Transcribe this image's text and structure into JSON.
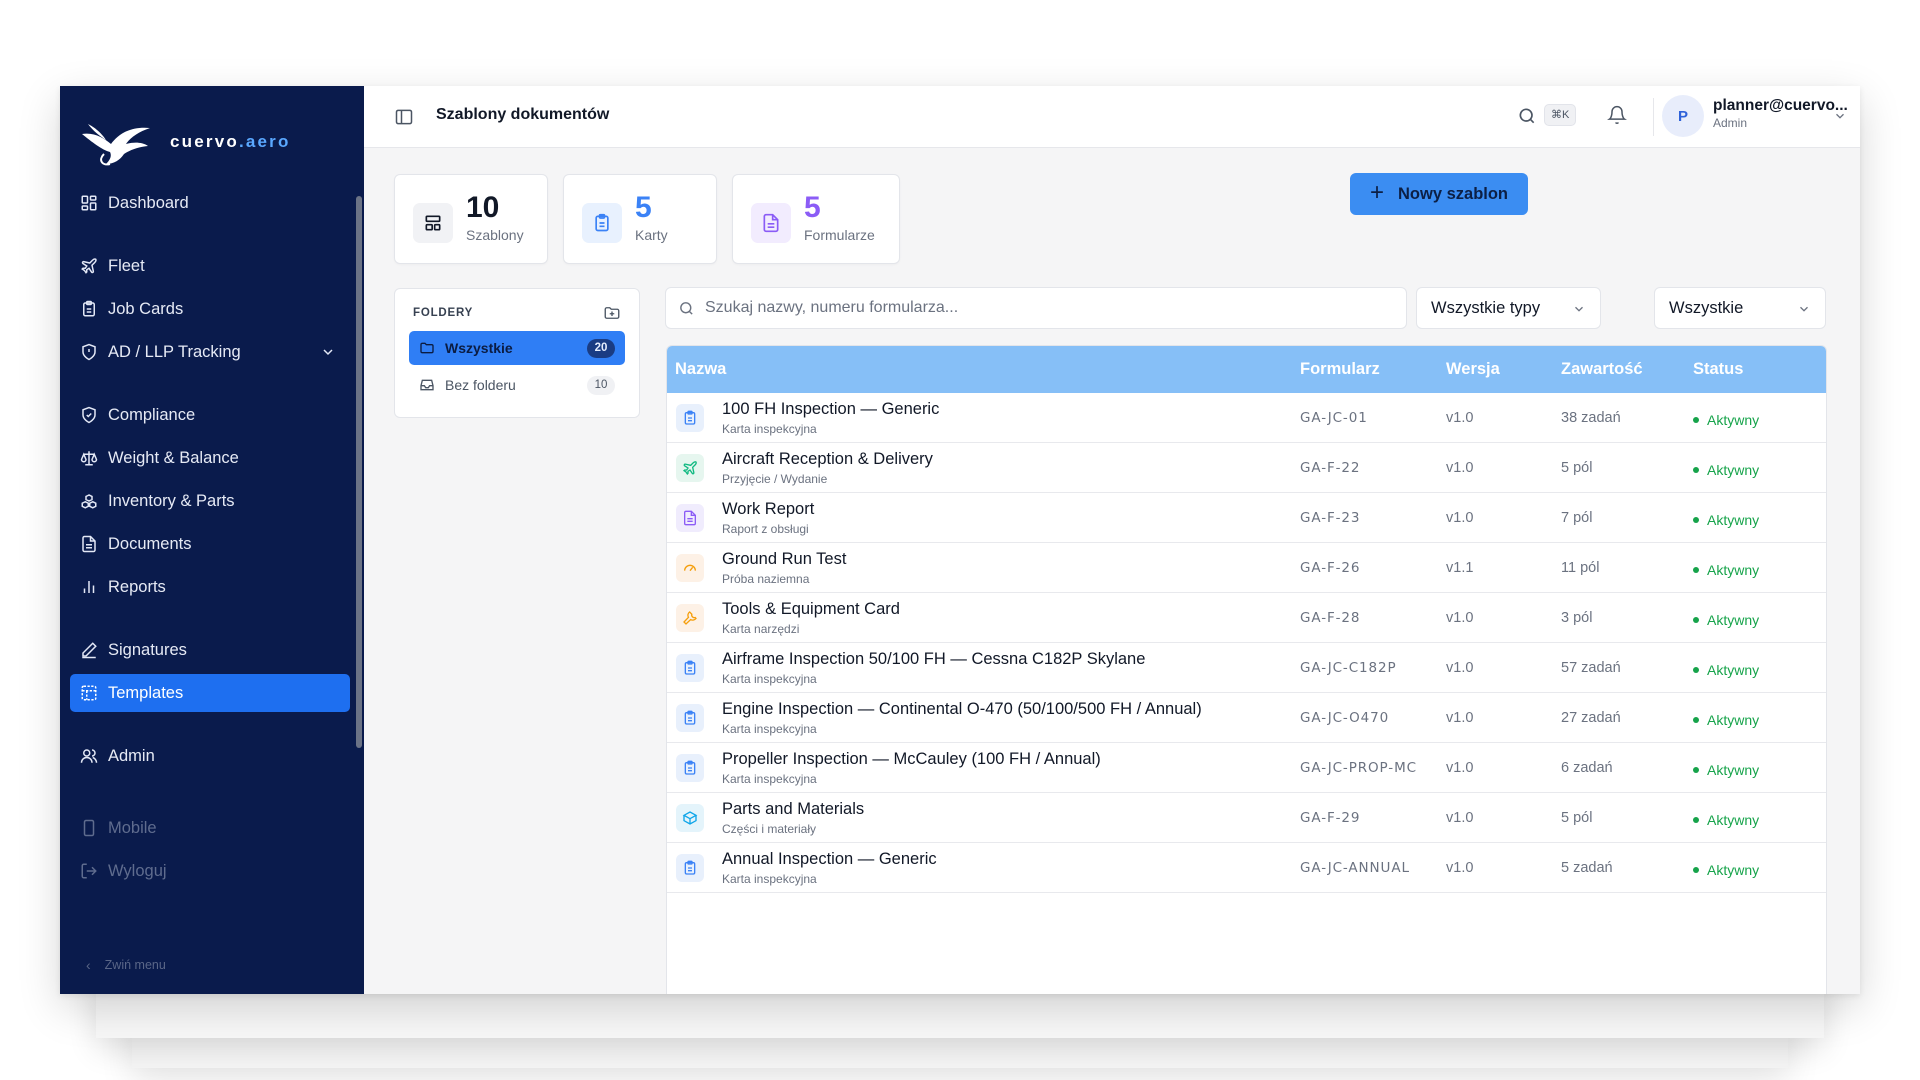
{
  "brand": {
    "name_prefix": "cuervo",
    "name_suffix": ".aero"
  },
  "sidebar": {
    "items": [
      {
        "label": "Dashboard",
        "icon": "dashboard-icon"
      },
      {
        "label": "Fleet",
        "icon": "plane-icon"
      },
      {
        "label": "Job Cards",
        "icon": "clipboard-icon"
      },
      {
        "label": "AD / LLP Tracking",
        "icon": "shield-alert-icon"
      },
      {
        "label": "Compliance",
        "icon": "shield-check-icon"
      },
      {
        "label": "Weight & Balance",
        "icon": "scale-icon"
      },
      {
        "label": "Inventory & Parts",
        "icon": "boxes-icon"
      },
      {
        "label": "Documents",
        "icon": "document-icon"
      },
      {
        "label": "Reports",
        "icon": "bar-chart-icon"
      },
      {
        "label": "Signatures",
        "icon": "pen-icon"
      },
      {
        "label": "Templates",
        "icon": "template-icon",
        "active": true
      },
      {
        "label": "Admin",
        "icon": "users-icon"
      },
      {
        "label": "Mobile",
        "icon": "smartphone-icon"
      },
      {
        "label": "Wyloguj",
        "icon": "logout-icon"
      }
    ],
    "collapse_label": "Zwiń menu"
  },
  "topbar": {
    "title": "Szablony dokumentów",
    "shortcut": "⌘K",
    "user_initial": "P",
    "user_email": "planner@cuervo...",
    "user_role": "Admin"
  },
  "stats": [
    {
      "value": "10",
      "label": "Szablony",
      "color": "#111827"
    },
    {
      "value": "5",
      "label": "Karty",
      "color": "#3b82f6"
    },
    {
      "value": "5",
      "label": "Formularze",
      "color": "#8b5cf6"
    }
  ],
  "new_button": "Nowy szablon",
  "folders": {
    "header": "FOLDERY",
    "items": [
      {
        "label": "Wszystkie",
        "count": "20",
        "active": true
      },
      {
        "label": "Bez folderu",
        "count": "10",
        "active": false
      }
    ]
  },
  "search": {
    "placeholder": "Szukaj nazwy, numeru formularza..."
  },
  "filters": {
    "type": "Wszystkie typy",
    "status": "Wszystkie"
  },
  "table": {
    "columns": [
      "Nazwa",
      "Formularz",
      "Wersja",
      "Zawartość",
      "Status"
    ],
    "rows": [
      {
        "name": "100 FH Inspection — Generic",
        "sub": "Karta inspekcyjna",
        "code": "GA-JC-01",
        "version": "v1.0",
        "content": "38 zadań",
        "status": "Aktywny",
        "icon": "clipboard-icon"
      },
      {
        "name": "Aircraft Reception & Delivery",
        "sub": "Przyjęcie / Wydanie",
        "code": "GA-F-22",
        "version": "v1.0",
        "content": "5 pól",
        "status": "Aktywny",
        "icon": "plane-icon"
      },
      {
        "name": "Work Report",
        "sub": "Raport z obsługi",
        "code": "GA-F-23",
        "version": "v1.0",
        "content": "7 pól",
        "status": "Aktywny",
        "icon": "document-icon"
      },
      {
        "name": "Ground Run Test",
        "sub": "Próba naziemna",
        "code": "GA-F-26",
        "version": "v1.1",
        "content": "11 pól",
        "status": "Aktywny",
        "icon": "gauge-icon"
      },
      {
        "name": "Tools & Equipment Card",
        "sub": "Karta narzędzi",
        "code": "GA-F-28",
        "version": "v1.0",
        "content": "3 pól",
        "status": "Aktywny",
        "icon": "wrench-icon"
      },
      {
        "name": "Airframe Inspection 50/100 FH — Cessna C182P Skylane",
        "sub": "Karta inspekcyjna",
        "code": "GA-JC-C182P",
        "version": "v1.0",
        "content": "57 zadań",
        "status": "Aktywny",
        "icon": "clipboard-icon"
      },
      {
        "name": "Engine Inspection — Continental O-470 (50/100/500 FH / Annual)",
        "sub": "Karta inspekcyjna",
        "code": "GA-JC-O470",
        "version": "v1.0",
        "content": "27 zadań",
        "status": "Aktywny",
        "icon": "clipboard-icon"
      },
      {
        "name": "Propeller Inspection — McCauley (100 FH / Annual)",
        "sub": "Karta inspekcyjna",
        "code": "GA-JC-PROP-MC",
        "version": "v1.0",
        "content": "6 zadań",
        "status": "Aktywny",
        "icon": "clipboard-icon"
      },
      {
        "name": "Parts and Materials",
        "sub": "Części i materiały",
        "code": "GA-F-29",
        "version": "v1.0",
        "content": "5 pól",
        "status": "Aktywny",
        "icon": "package-icon"
      },
      {
        "name": "Annual Inspection — Generic",
        "sub": "Karta inspekcyjna",
        "code": "GA-JC-ANNUAL",
        "version": "v1.0",
        "content": "5 zadań",
        "status": "Aktywny",
        "icon": "clipboard-icon"
      }
    ]
  },
  "colors": {
    "sidebar_bg": "#0a1b4c",
    "accent": "#1e6ff0",
    "table_header": "#86bff7",
    "status_active": "#16a34a"
  }
}
